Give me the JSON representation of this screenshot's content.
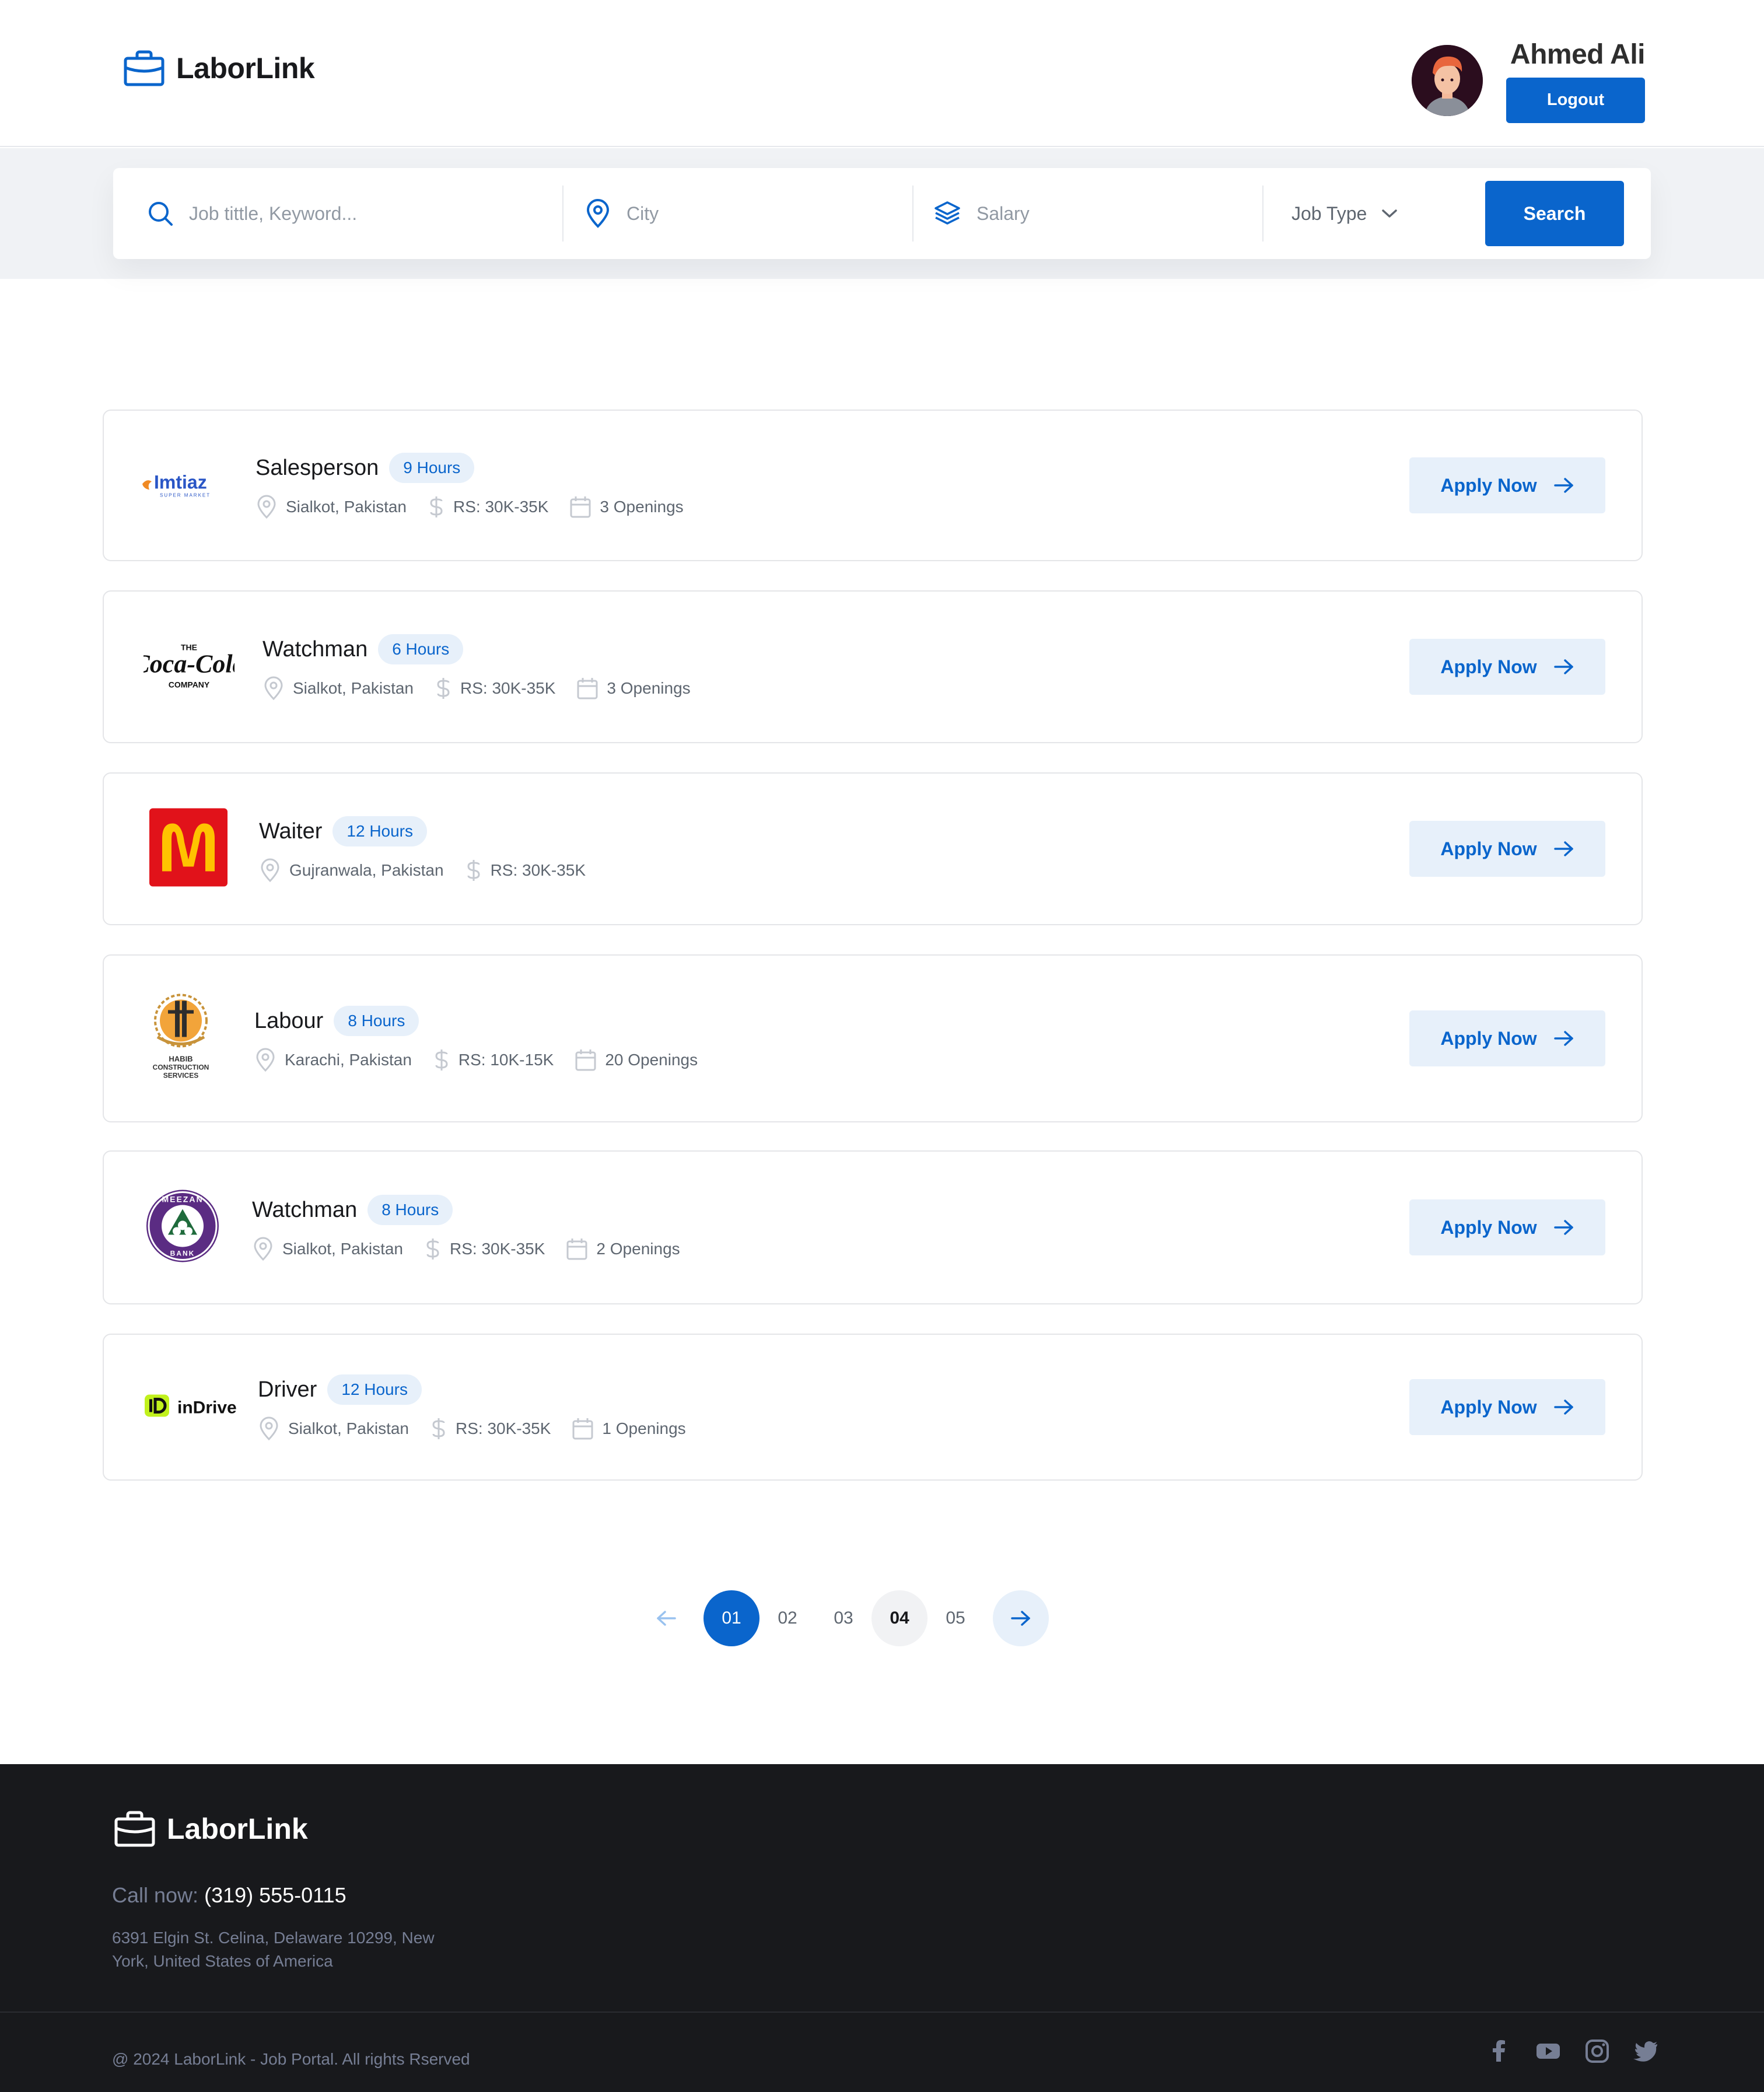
{
  "header": {
    "brand": "LaborLink",
    "user_name": "Ahmed Ali",
    "logout_label": "Logout"
  },
  "search": {
    "keyword_placeholder": "Job tittle, Keyword...",
    "city_placeholder": "City",
    "salary_placeholder": "Salary",
    "job_type_label": "Job Type",
    "search_label": "Search"
  },
  "jobs": [
    {
      "company": "Imtiaz",
      "title": "Salesperson",
      "hours": "9 Hours",
      "location": "Sialkot, Pakistan",
      "salary": "RS: 30K-35K",
      "openings": "3 Openings",
      "apply": "Apply Now"
    },
    {
      "company": "The Coca-Cola Company",
      "title": "Watchman",
      "hours": "6 Hours",
      "location": "Sialkot, Pakistan",
      "salary": "RS: 30K-35K",
      "openings": "3 Openings",
      "apply": "Apply Now"
    },
    {
      "company": "McDonald's",
      "title": "Waiter",
      "hours": "12 Hours",
      "location": "Gujranwala, Pakistan",
      "salary": "RS: 30K-35K",
      "openings": "",
      "apply": "Apply Now"
    },
    {
      "company": "Habib Construction Services",
      "title": "Labour",
      "hours": "8 Hours",
      "location": "Karachi, Pakistan",
      "salary": "RS: 10K-15K",
      "openings": "20 Openings",
      "apply": "Apply Now"
    },
    {
      "company": "Meezan Bank",
      "title": "Watchman",
      "hours": "8 Hours",
      "location": "Sialkot, Pakistan",
      "salary": "RS: 30K-35K",
      "openings": "2 Openings",
      "apply": "Apply Now"
    },
    {
      "company": "inDrive",
      "title": "Driver",
      "hours": "12 Hours",
      "location": "Sialkot, Pakistan",
      "salary": "RS: 30K-35K",
      "openings": "1 Openings",
      "apply": "Apply Now"
    }
  ],
  "pagination": {
    "pages": [
      "01",
      "02",
      "03",
      "04",
      "05"
    ],
    "current": "01"
  },
  "footer": {
    "brand": "LaborLink",
    "call_label": "Call now:",
    "phone": "(319) 555-0115",
    "address": "6391 Elgin St. Celina, Delaware 10299, New York, United States of America",
    "copyright": "@ 2024 LaborLink  - Job Portal. All rights Rserved"
  },
  "logo_text": {
    "imtiaz": "Imtiaz",
    "imtiaz_sub": "SUPER MARKET",
    "coke_the": "THE",
    "coke_script": "Coca-Cola",
    "coke_company": "COMPANY",
    "habib": "HABIB",
    "habib_line2": "CONSTRUCTION",
    "habib_line3": "SERVICES",
    "meezan": "MEEZAN",
    "meezan_bank": "BANK",
    "indrive": "inDrive"
  },
  "colors": {
    "primary": "#0a65cc",
    "primary_light": "#e7f0fa",
    "footer_bg": "#18191c"
  }
}
